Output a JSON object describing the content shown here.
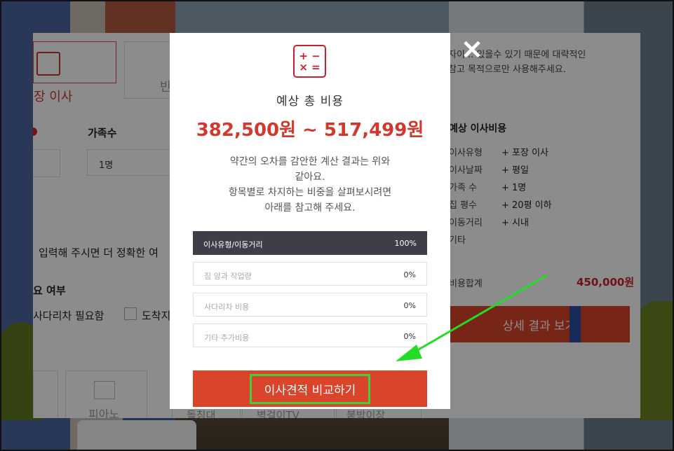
{
  "background_page": {
    "tabs": [
      {
        "label": "장 이사"
      },
      {
        "label": "반"
      }
    ],
    "family_label": "가족수",
    "family_value": "1명",
    "hint": "입력해 주시면 더 정확한 여",
    "need_label": "요 여부",
    "ladder_label": "사다리차 필요함",
    "arrive_label": "도착지",
    "cards": [
      {
        "label": "피아노"
      },
      {
        "label": "돌침대"
      },
      {
        "label": "벽걸이TV"
      },
      {
        "label": "붙박이장"
      }
    ],
    "note_lines": [
      "자이... 있을수 있기 때문에 대략적인",
      "참고 목적으로만 사용해주세요."
    ],
    "summary_title": "예상 이사비용",
    "summary_rows": [
      {
        "k": "이사유형",
        "v": "+ 포장 이사"
      },
      {
        "k": "이사날짜",
        "v": "+ 평일"
      },
      {
        "k": "가족 수",
        "v": "+ 1명"
      },
      {
        "k": "집 평수",
        "v": "+ 20평 이하"
      },
      {
        "k": "이동거리",
        "v": "+ 시내"
      },
      {
        "k": "기타",
        "v": ""
      }
    ],
    "sum_label": "비용합계",
    "sum_value": "450,000원",
    "detail_button": "상세 결과 보기"
  },
  "modal": {
    "icon_text_top": "+ −",
    "icon_text_bottom": "× =",
    "title": "예상 총 비용",
    "price": "382,500원 ~ 517,499원",
    "desc_lines": [
      "약간의 오차를 감안한 계산 결과는 위와",
      "같아요.",
      "항목별로 차지하는 비중을 살펴보시려면",
      "아래를 참고해 주세요."
    ],
    "bars": [
      {
        "label": "이사유형/이동거리",
        "percent": "100%",
        "value": 100
      },
      {
        "label": "짐 양과 작업량",
        "percent": "0%",
        "value": 0
      },
      {
        "label": "사다리차 비용",
        "percent": "0%",
        "value": 0
      },
      {
        "label": "기타 추가비용",
        "percent": "0%",
        "value": 0
      }
    ],
    "compare_button": "이사견적 비교하기",
    "close_icon": "×"
  },
  "colors": {
    "accent": "#d9442a",
    "price": "#cf3a2f",
    "highlight": "#3bd23b"
  }
}
